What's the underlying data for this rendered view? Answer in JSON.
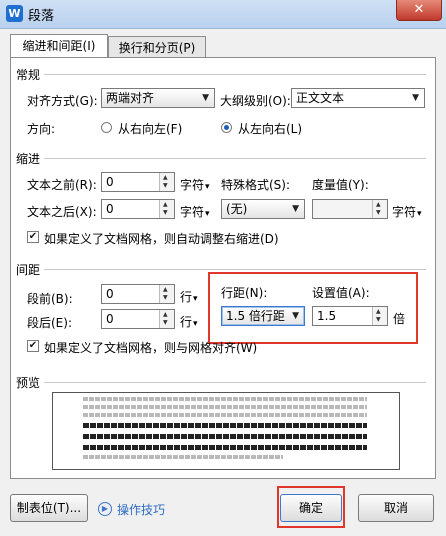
{
  "window": {
    "title": "段落",
    "close_glyph": "✕"
  },
  "tabs": [
    {
      "label": "缩进和间距(I)"
    },
    {
      "label": "换行和分页(P)"
    }
  ],
  "general": {
    "section": "常规",
    "alignment_label": "对齐方式(G):",
    "alignment_value": "两端对齐",
    "outline_label": "大纲级别(O):",
    "outline_value": "正文文本",
    "direction_label": "方向:",
    "rtl_label": "从右向左(F)",
    "ltr_label": "从左向右(L)",
    "direction_selected": "ltr"
  },
  "indent": {
    "section": "缩进",
    "before_label": "文本之前(R):",
    "before_value": "0",
    "before_unit": "字符",
    "after_label": "文本之后(X):",
    "after_value": "0",
    "after_unit": "字符",
    "special_label": "特殊格式(S):",
    "special_value": "(无)",
    "measure_label": "度量值(Y):",
    "measure_value": "",
    "measure_unit": "字符",
    "auto_adjust_label": "如果定义了文档网格，则自动调整右缩进(D)",
    "auto_adjust_checked": true
  },
  "spacing": {
    "section": "间距",
    "before_label": "段前(B):",
    "before_value": "0",
    "before_unit": "行",
    "after_label": "段后(E):",
    "after_value": "0",
    "after_unit": "行",
    "line_label": "行距(N):",
    "line_value": "1.5 倍行距",
    "setting_label": "设置值(A):",
    "setting_value": "1.5",
    "setting_unit": "倍",
    "snap_grid_label": "如果定义了文档网格，则与网格对齐(W)",
    "snap_grid_checked": true
  },
  "preview": {
    "section": "预览"
  },
  "footer": {
    "tabs_button": "制表位(T)...",
    "tips_label": "操作技巧",
    "ok_button": "确定",
    "cancel_button": "取消"
  },
  "colors": {
    "highlight": "#e0362c",
    "accent": "#1a5fb4"
  }
}
